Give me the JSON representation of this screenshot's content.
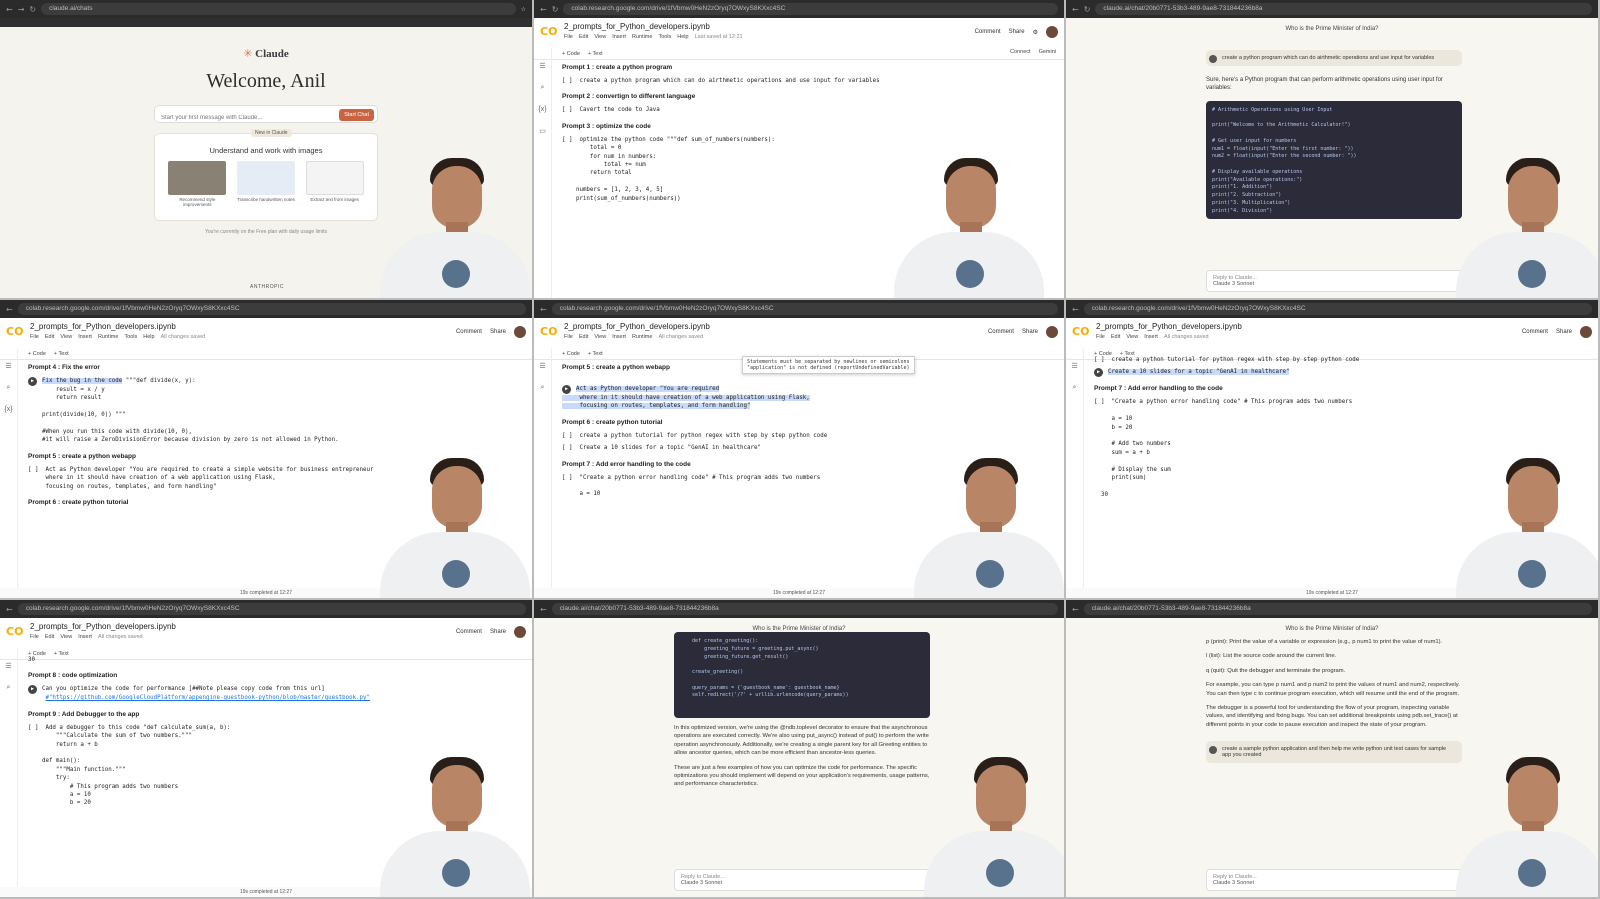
{
  "panels": {
    "p1": {
      "url": "claude.ai/chats",
      "brand": "Claude",
      "welcome": "Welcome, Anil",
      "input_placeholder": "Start your first message with Claude...",
      "start_button": "Start Chat",
      "learn_badge": "New in Claude",
      "card_title": "Understand and work with images",
      "thumbs": [
        "Recommend style improvements",
        "Transcribe handwritten notes",
        "Extract text from images"
      ],
      "plan_note": "You're currently on the Free plan with daily usage limits",
      "footer": "ANTHROPIC"
    },
    "p2": {
      "url": "colab.research.google.com/drive/1fVbmw0HeN2zOryq7OWxyS8KXxc4SC",
      "file": "2_prompts_for_Python_developers.ipynb",
      "menu": [
        "File",
        "Edit",
        "View",
        "Insert",
        "Runtime",
        "Tools",
        "Help"
      ],
      "saved": "Last saved at 12:21",
      "comment": "Comment",
      "share": "Share",
      "code_btn": "+ Code",
      "text_btn": "+ Text",
      "connect": "Connect",
      "gemini": "Gemini",
      "h1": "Prompt 1 : create a python program",
      "c1": "[ ]  create a python program which can do airthmetic operations and use input for variables",
      "h2": "Prompt 2 : convertign to different language",
      "c2": "[ ]  Cavert the code to Java",
      "h3": "Prompt 3 : optimize the code",
      "c3": "[ ]  optimize the python code \"\"\"def sum_of_numbers(numbers):\n        total = 0\n        for num in numbers:\n            total += num\n        return total\n\n    numbers = [1, 2, 3, 4, 5]\n    print(sum_of_numbers(numbers))"
    },
    "p3": {
      "url": "claude.ai/chat/20b0771-53b3-489-9ae8-731844236b8a",
      "title": "Who is the Prime Minister of India?",
      "user": "create a python program which can do airthmetic operations and use input for variables",
      "reply": "Sure, here's a Python program that can perform arithmetic operations using user input for variables:",
      "code": "# Arithmetic Operations using User Input\n\nprint(\"Welcome to the Arithmetic Calculator!\")\n\n# Get user input for numbers\nnum1 = float(input(\"Enter the first number: \"))\nnum2 = float(input(\"Enter the second number: \"))\n\n# Display available operations\nprint(\"Available operations:\")\nprint(\"1. Addition\")\nprint(\"2. Subtraction\")\nprint(\"3. Multiplication\")\nprint(\"4. Division\")",
      "reply_placeholder": "Reply to Claude...",
      "model": "Claude 3 Sonnet"
    },
    "p4": {
      "file": "2_prompts_for_Python_developers.ipynb",
      "saved": "All changes saved",
      "h1": "Prompt 4 : Fix the error",
      "c1a": "Fix the bug in the code",
      "c1b": " \"\"\"def divide(x, y):\n        result = x / y\n        return result\n\n    print(divide(10, 0)) \"\"\"\n\n    #When you run this code with divide(10, 0),\n    #it will raise a ZeroDivisionError because division by zero is not allowed in Python.",
      "h2": "Prompt 5 : create a python webapp",
      "c2": "[ ]  Act as Python developer \"You are required to create a simple website for business entrepreneur\n     where in it should have creation of a web application using Flask,\n     focusing on routes, templates, and form handling\"",
      "h3": "Prompt 6 : create python tutorial",
      "status": "19s   completed at 12:27"
    },
    "p5": {
      "file": "2_prompts_for_Python_developers.ipynb",
      "saved": "All changes saved",
      "h1": "Prompt 5 : create a python webapp",
      "tooltip1": "Statements must be separated by newlines or semicolons",
      "tooltip2": "\"application\" is not defined (reportUndefinedVariable)",
      "c1": "Act as Python developer \"You are required\n     where in it should have creation of a web application using Flask,\n     focusing on routes, templates, and form handling\"",
      "h2": "Prompt 6 : create python tutorial",
      "c2": "[ ]  create a python tutorial for python regex with step by step python code",
      "c3": "[ ]  Create a 10 slides for a topic \"GenAI in healthcare\"",
      "h3": "Prompt 7 : Add error handling to the code",
      "c4": "[ ]  \"Create a python error handling code\" # This program adds two numbers\n\n     a = 10",
      "status": "19s   completed at 12:27"
    },
    "p6": {
      "file": "2_prompts_for_Python_developers.ipynb",
      "saved": "All changes saved",
      "c1": "[ ]  create a python tutorial for python regex with step by step python code",
      "c2": "Create a 10 slides for a topic \"GenAI in healthcare\"",
      "h1": "Prompt 7 : Add error handling to the code",
      "c3": "[ ]  \"Create a python error handling code\" # This program adds two numbers\n\n     a = 10\n     b = 20\n\n     # Add two numbers\n     sum = a + b\n\n     # Display the sum\n     print(sum)\n\n  30",
      "status": "19s   completed at 12:27"
    },
    "p7": {
      "file": "2_prompts_for_Python_developers.ipynb",
      "saved": "All changes saved",
      "out": "30",
      "h1": "Prompt 8 : code optimization",
      "c1": "Can you optimize the code for performance [##Note please copy code from this url]",
      "link": "#\"https://github.com/GoogleCloudPlatform/appengine-guestbook-python/blob/master/guestbook.py\"",
      "h2": "Prompt 9 : Add Debugger to the app",
      "c2": "[ ]  Add a debugger to this code \"def calculate_sum(a, b):\n        \"\"\"Calculate the sum of two numbers.\"\"\"\n        return a + b\n\n    def main():\n        \"\"\"Main function.\"\"\"\n        try:\n            # This program adds two numbers\n            a = 10\n            b = 20",
      "status": "19s   completed at 12:27"
    },
    "p8": {
      "title": "Who is the Prime Minister of India?",
      "code": "    def create_greeting():\n        greeting_future = greeting.put_async()\n        greeting_future.get_result()\n\n    create_greeting()\n\n    query_params = {'guestbook_name': guestbook_name}\n    self.redirect('/?' + urllib.urlencode(query_params))",
      "p1": "In this optimized version, we're using the @ndb.toplevel decorator to ensure that the asynchronous operations are executed correctly. We're also using put_async() instead of put() to perform the write operation asynchronously. Additionally, we're creating a single parent key for all Greeting entities to allow ancestor queries, which can be more efficient than ancestor-less queries.",
      "p2": "These are just a few examples of how you can optimize the code for performance. The specific optimizations you should implement will depend on your application's requirements, usage patterns, and performance characteristics.",
      "reply_placeholder": "Reply to Claude...",
      "model": "Claude 3 Sonnet"
    },
    "p9": {
      "title": "Who is the Prime Minister of India?",
      "b1": "p (print): Print the value of a variable or expression (e.g., p num1 to print the value of num1).",
      "b2": "l (list): List the source code around the current line.",
      "b3": "q (quit): Quit the debugger and terminate the program.",
      "p1": "For example, you can type p num1 and p num2 to print the values of num1 and num2, respectively. You can then type c to continue program execution, which will resume until the end of the program.",
      "p2": "The debugger is a powerful tool for understanding the flow of your program, inspecting variable values, and identifying and fixing bugs. You can set additional breakpoints using pdb.set_trace() at different points in your code to pause execution and inspect the state of your program.",
      "user": "create a sample python application and then help me write python unit test cases for sample app you created",
      "reply_placeholder": "Reply to Claude...",
      "model": "Claude 3 Sonnet"
    }
  }
}
